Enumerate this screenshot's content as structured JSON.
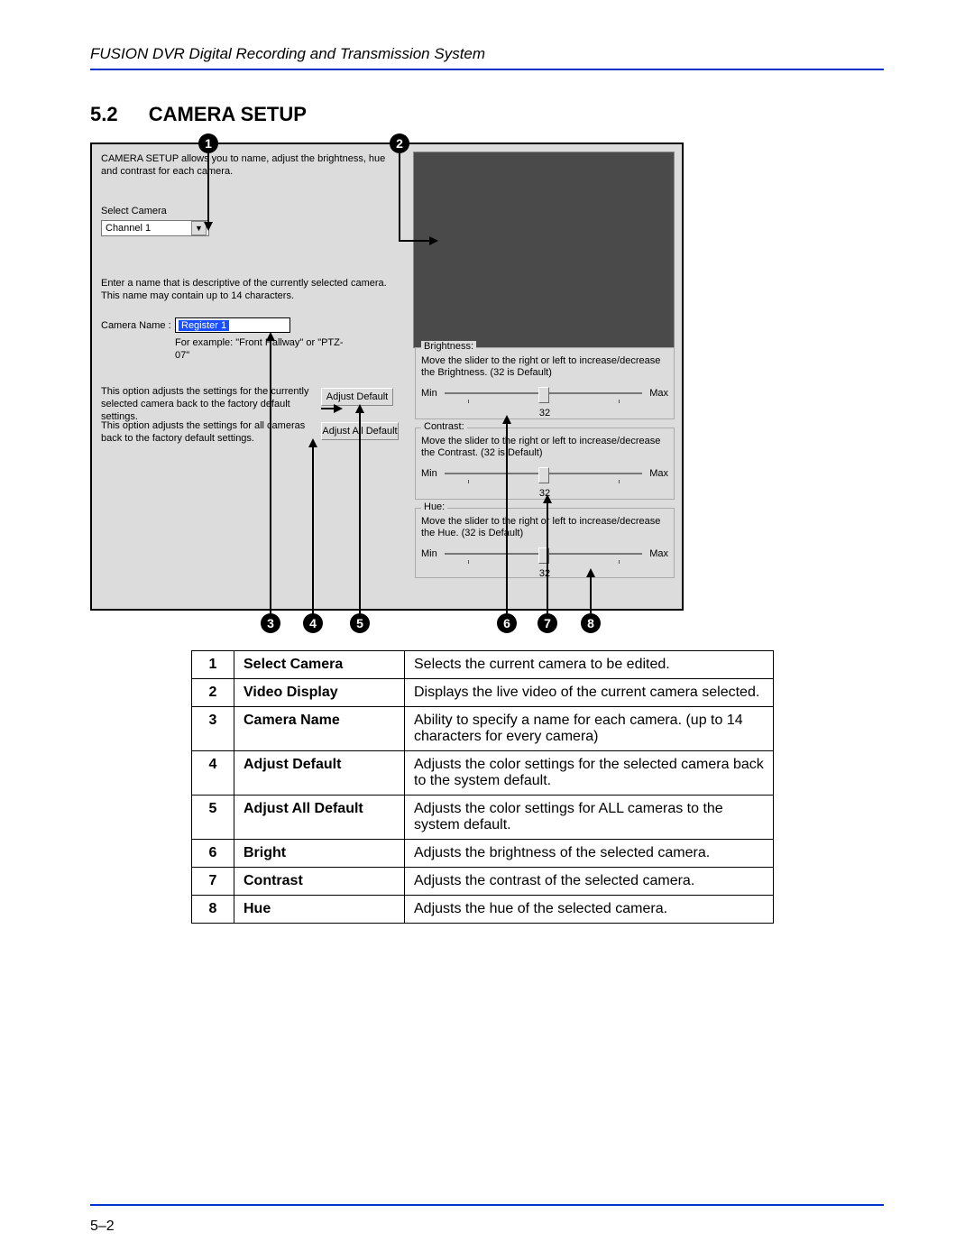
{
  "doc_header": "FUSION DVR Digital Recording and Transmission System",
  "section_number": "5.2",
  "section_title": "CAMERA SETUP",
  "page_number": "5–2",
  "dialog": {
    "intro": "CAMERA SETUP allows you to name, adjust the brightness, hue and contrast for each camera.",
    "select_label": "Select Camera",
    "select_value": "Channel 1",
    "name_desc": "Enter a name that is descriptive of the currently selected camera. This name may contain up to 14 characters.",
    "name_label": "Camera Name :",
    "name_value": "Register 1",
    "name_example": "For example: \"Front Hallway\" or \"PTZ-07\"",
    "adjust_default_desc": "This option adjusts the settings for the currently selected camera back to the factory default settings.",
    "adjust_all_desc": "This option adjusts the settings for all cameras back to the factory default settings.",
    "btn_adjust_default": "Adjust Default",
    "btn_adjust_all": "Adjust All Default",
    "brightness": {
      "legend": "Brightness:",
      "desc": "Move the slider to the right or left to increase/decrease the Brightness. (32 is Default)",
      "min": "Min",
      "max": "Max",
      "value": "32"
    },
    "contrast": {
      "legend": "Contrast:",
      "desc": "Move the slider to the right or left to increase/decrease the Contrast. (32 is Default)",
      "min": "Min",
      "max": "Max",
      "value": "32"
    },
    "hue": {
      "legend": "Hue:",
      "desc": "Move the slider to the right or left to increase/decrease the Hue. (32 is Default)",
      "min": "Min",
      "max": "Max",
      "value": "32"
    }
  },
  "markers": {
    "m1": "1",
    "m2": "2",
    "m3": "3",
    "m4": "4",
    "m5": "5",
    "m6": "6",
    "m7": "7",
    "m8": "8"
  },
  "table": [
    {
      "n": "1",
      "name": "Select Camera",
      "desc": "Selects the current camera to be edited."
    },
    {
      "n": "2",
      "name": "Video Display",
      "desc": "Displays the live video of the current camera selected."
    },
    {
      "n": "3",
      "name": "Camera Name",
      "desc": "Ability to specify a name for each camera. (up to 14 characters for every camera)"
    },
    {
      "n": "4",
      "name": "Adjust Default",
      "desc": "Adjusts the color settings for the selected camera back to the system default."
    },
    {
      "n": "5",
      "name": "Adjust All Default",
      "desc": "Adjusts the color settings for ALL cameras to the system default."
    },
    {
      "n": "6",
      "name": "Bright",
      "desc": "Adjusts the brightness of the selected camera."
    },
    {
      "n": "7",
      "name": "Contrast",
      "desc": "Adjusts the contrast of the selected camera."
    },
    {
      "n": "8",
      "name": "Hue",
      "desc": "Adjusts the hue of the selected camera."
    }
  ]
}
